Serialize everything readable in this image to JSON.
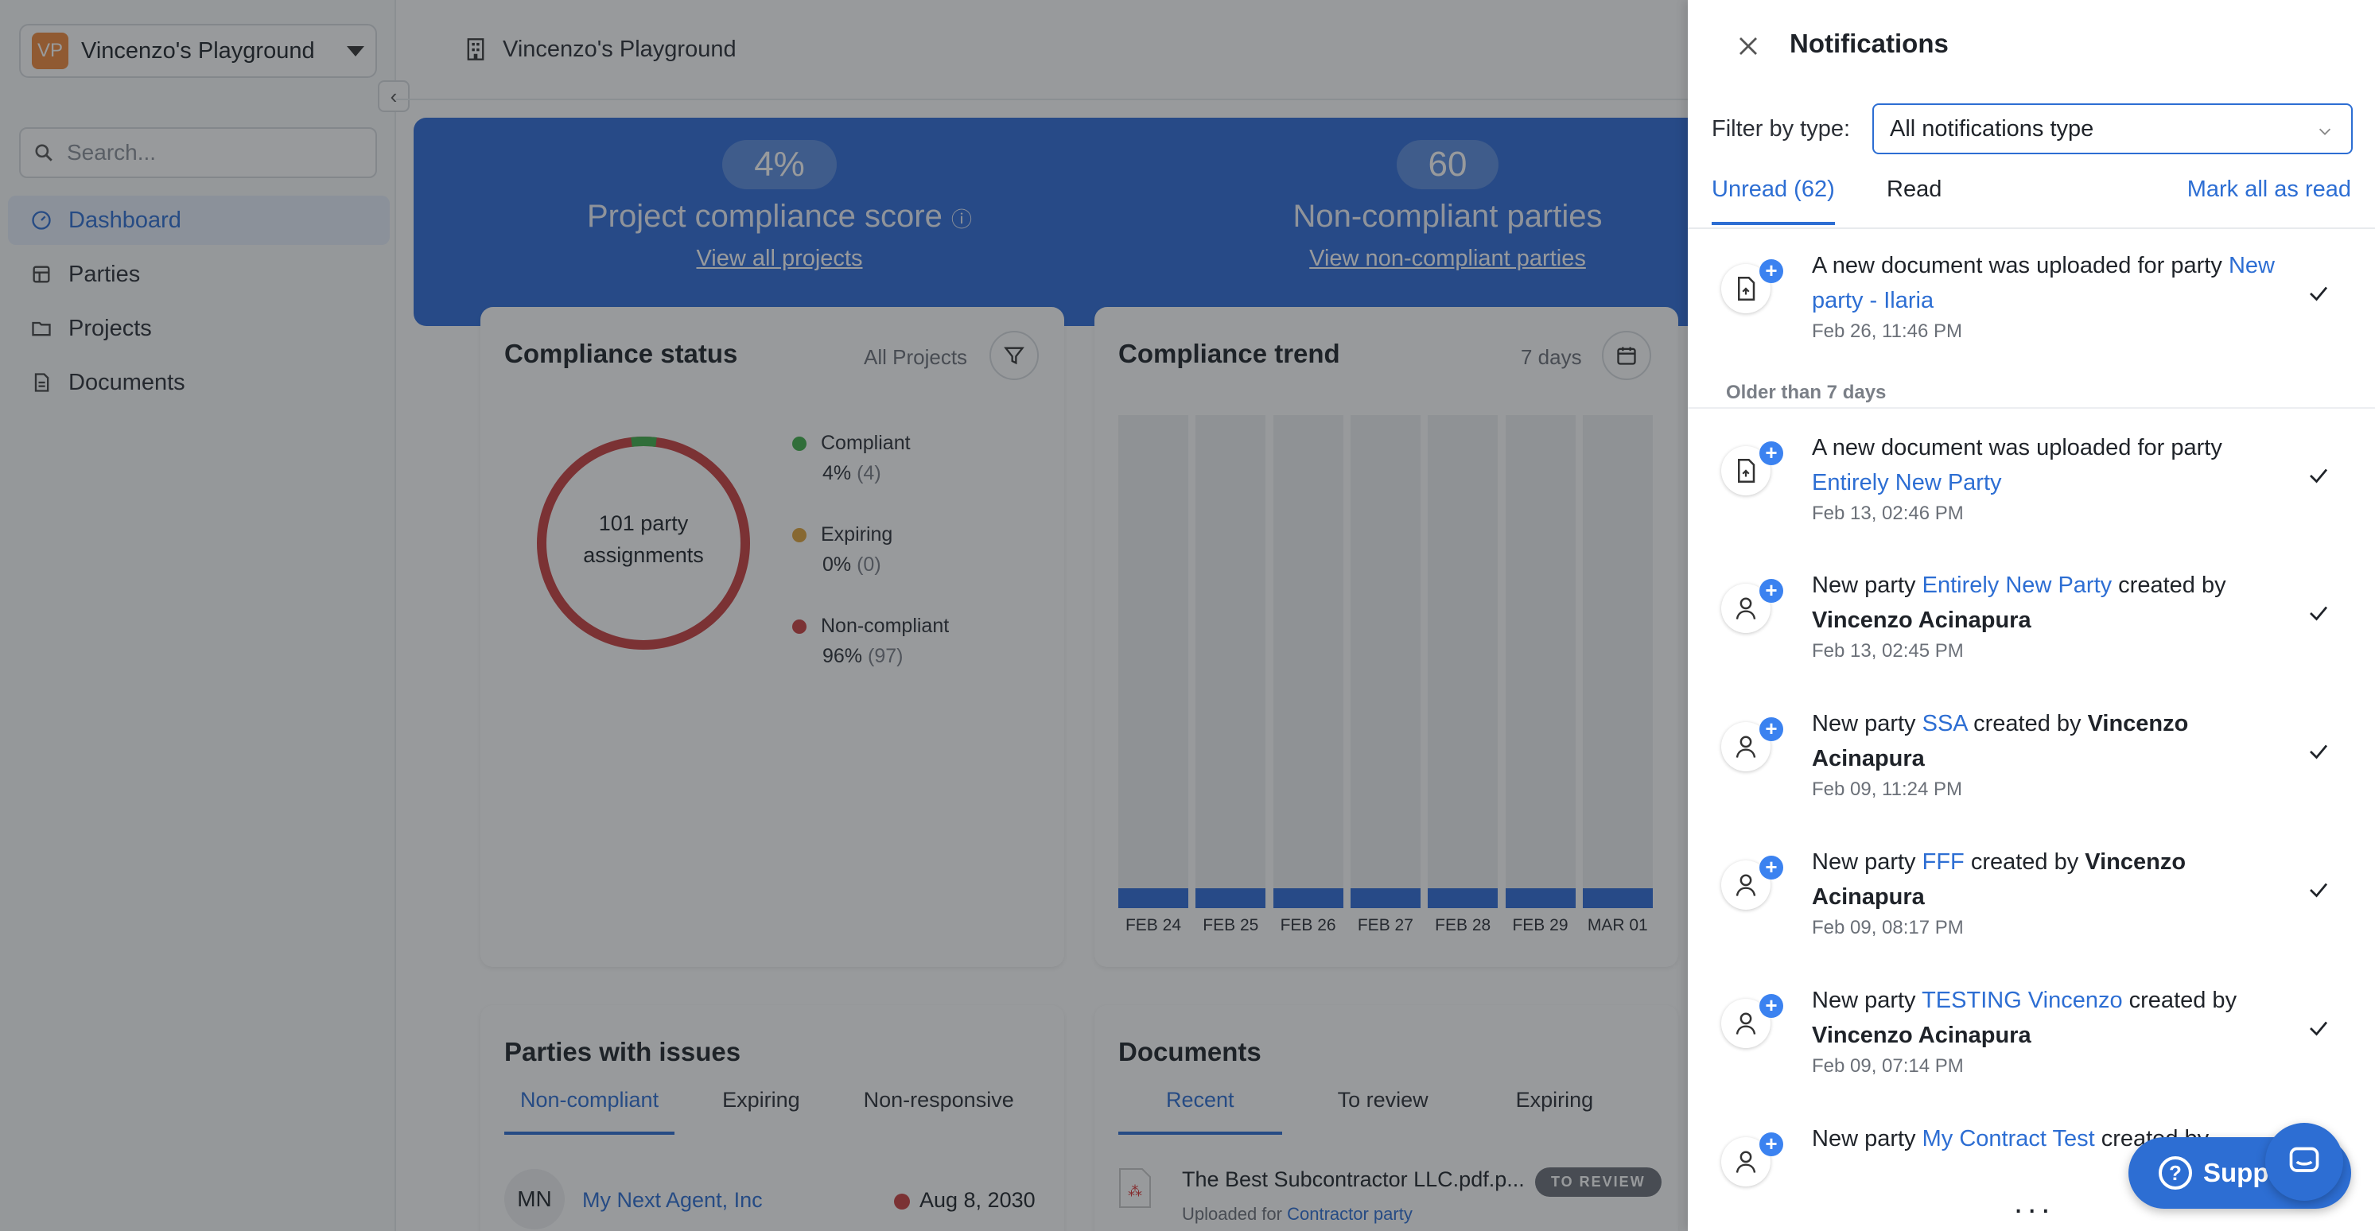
{
  "sidebar": {
    "workspace_initials": "VP",
    "workspace_name": "Vincenzo's Playground",
    "search_placeholder": "Search...",
    "items": [
      {
        "label": "Dashboard"
      },
      {
        "label": "Parties"
      },
      {
        "label": "Projects"
      },
      {
        "label": "Documents"
      }
    ]
  },
  "header": {
    "title": "Vincenzo's Playground"
  },
  "hero": {
    "score_value": "4%",
    "score_label": "Project compliance score",
    "score_link": "View all projects",
    "noncompliant_value": "60",
    "noncompliant_label": "Non-compliant parties",
    "noncompliant_link": "View non-compliant parties"
  },
  "compliance_status": {
    "title": "Compliance status",
    "filter_label": "All Projects",
    "center_line1": "101 party",
    "center_line2": "assignments",
    "legend": [
      {
        "label": "Compliant",
        "pct": "4%",
        "count": "(4)",
        "color": "#3fae49"
      },
      {
        "label": "Expiring",
        "pct": "0%",
        "count": "(0)",
        "color": "#e0a33a"
      },
      {
        "label": "Non-compliant",
        "pct": "96%",
        "count": "(97)",
        "color": "#c94040"
      }
    ]
  },
  "compliance_trend": {
    "title": "Compliance trend",
    "range_label": "7 days",
    "labels": [
      "FEB 24",
      "FEB 25",
      "FEB 26",
      "FEB 27",
      "FEB 28",
      "FEB 29",
      "MAR 01"
    ]
  },
  "chart_data": {
    "type": "bar",
    "categories": [
      "FEB 24",
      "FEB 25",
      "FEB 26",
      "FEB 27",
      "FEB 28",
      "FEB 29",
      "MAR 01"
    ],
    "values": [
      4,
      4,
      4,
      4,
      4,
      4,
      4
    ],
    "ylim": [
      0,
      100
    ],
    "colors": {
      "fill": "#2f6cd8",
      "track": "#eef0f3"
    }
  },
  "parties_issues": {
    "title": "Parties with issues",
    "tabs": [
      "Non-compliant",
      "Expiring",
      "Non-responsive"
    ],
    "row": {
      "initials": "MN",
      "name": "My Next Agent, Inc",
      "date": "Aug 8, 2030"
    }
  },
  "documents": {
    "title": "Documents",
    "tabs": [
      "Recent",
      "To review",
      "Expiring"
    ],
    "row": {
      "file": "The Best Subcontractor LLC.pdf.p...",
      "badge": "TO REVIEW",
      "uploaded_prefix": "Uploaded for",
      "uploaded_party": "Contractor party"
    }
  },
  "drawer": {
    "title": "Notifications",
    "filter_label": "Filter by type:",
    "filter_value": "All notifications type",
    "tab_unread": "Unread (62)",
    "tab_read": "Read",
    "mark_all": "Mark all as read",
    "older_label": "Older than 7 days",
    "more": "...",
    "notifications": [
      {
        "pre": "A new document was uploaded for party ",
        "link": "New party - Ilaria",
        "post": "",
        "by": "",
        "time": "Feb 26, 11:46 PM"
      },
      {
        "pre": "A new document was uploaded for party ",
        "link": "Entirely New Party",
        "post": "",
        "by": "",
        "time": "Feb 13, 02:46 PM"
      },
      {
        "pre": "New party ",
        "link": "Entirely New Party",
        "post": " created by ",
        "by": "Vincenzo Acinapura",
        "time": "Feb 13, 02:45 PM"
      },
      {
        "pre": "New party ",
        "link": "SSA",
        "post": " created by ",
        "by": "Vincenzo Acinapura",
        "time": "Feb 09, 11:24 PM"
      },
      {
        "pre": "New party ",
        "link": "FFF",
        "post": " created by ",
        "by": "Vincenzo Acinapura",
        "time": "Feb 09, 08:17 PM"
      },
      {
        "pre": "New party ",
        "link": "TESTING Vincenzo",
        "post": " created by ",
        "by": "Vincenzo Acinapura",
        "time": "Feb 09, 07:14 PM"
      },
      {
        "pre": "New party ",
        "link": "My Contract Test",
        "post": " created by",
        "by": "",
        "time": ""
      }
    ]
  },
  "support": {
    "label": "Supp"
  }
}
